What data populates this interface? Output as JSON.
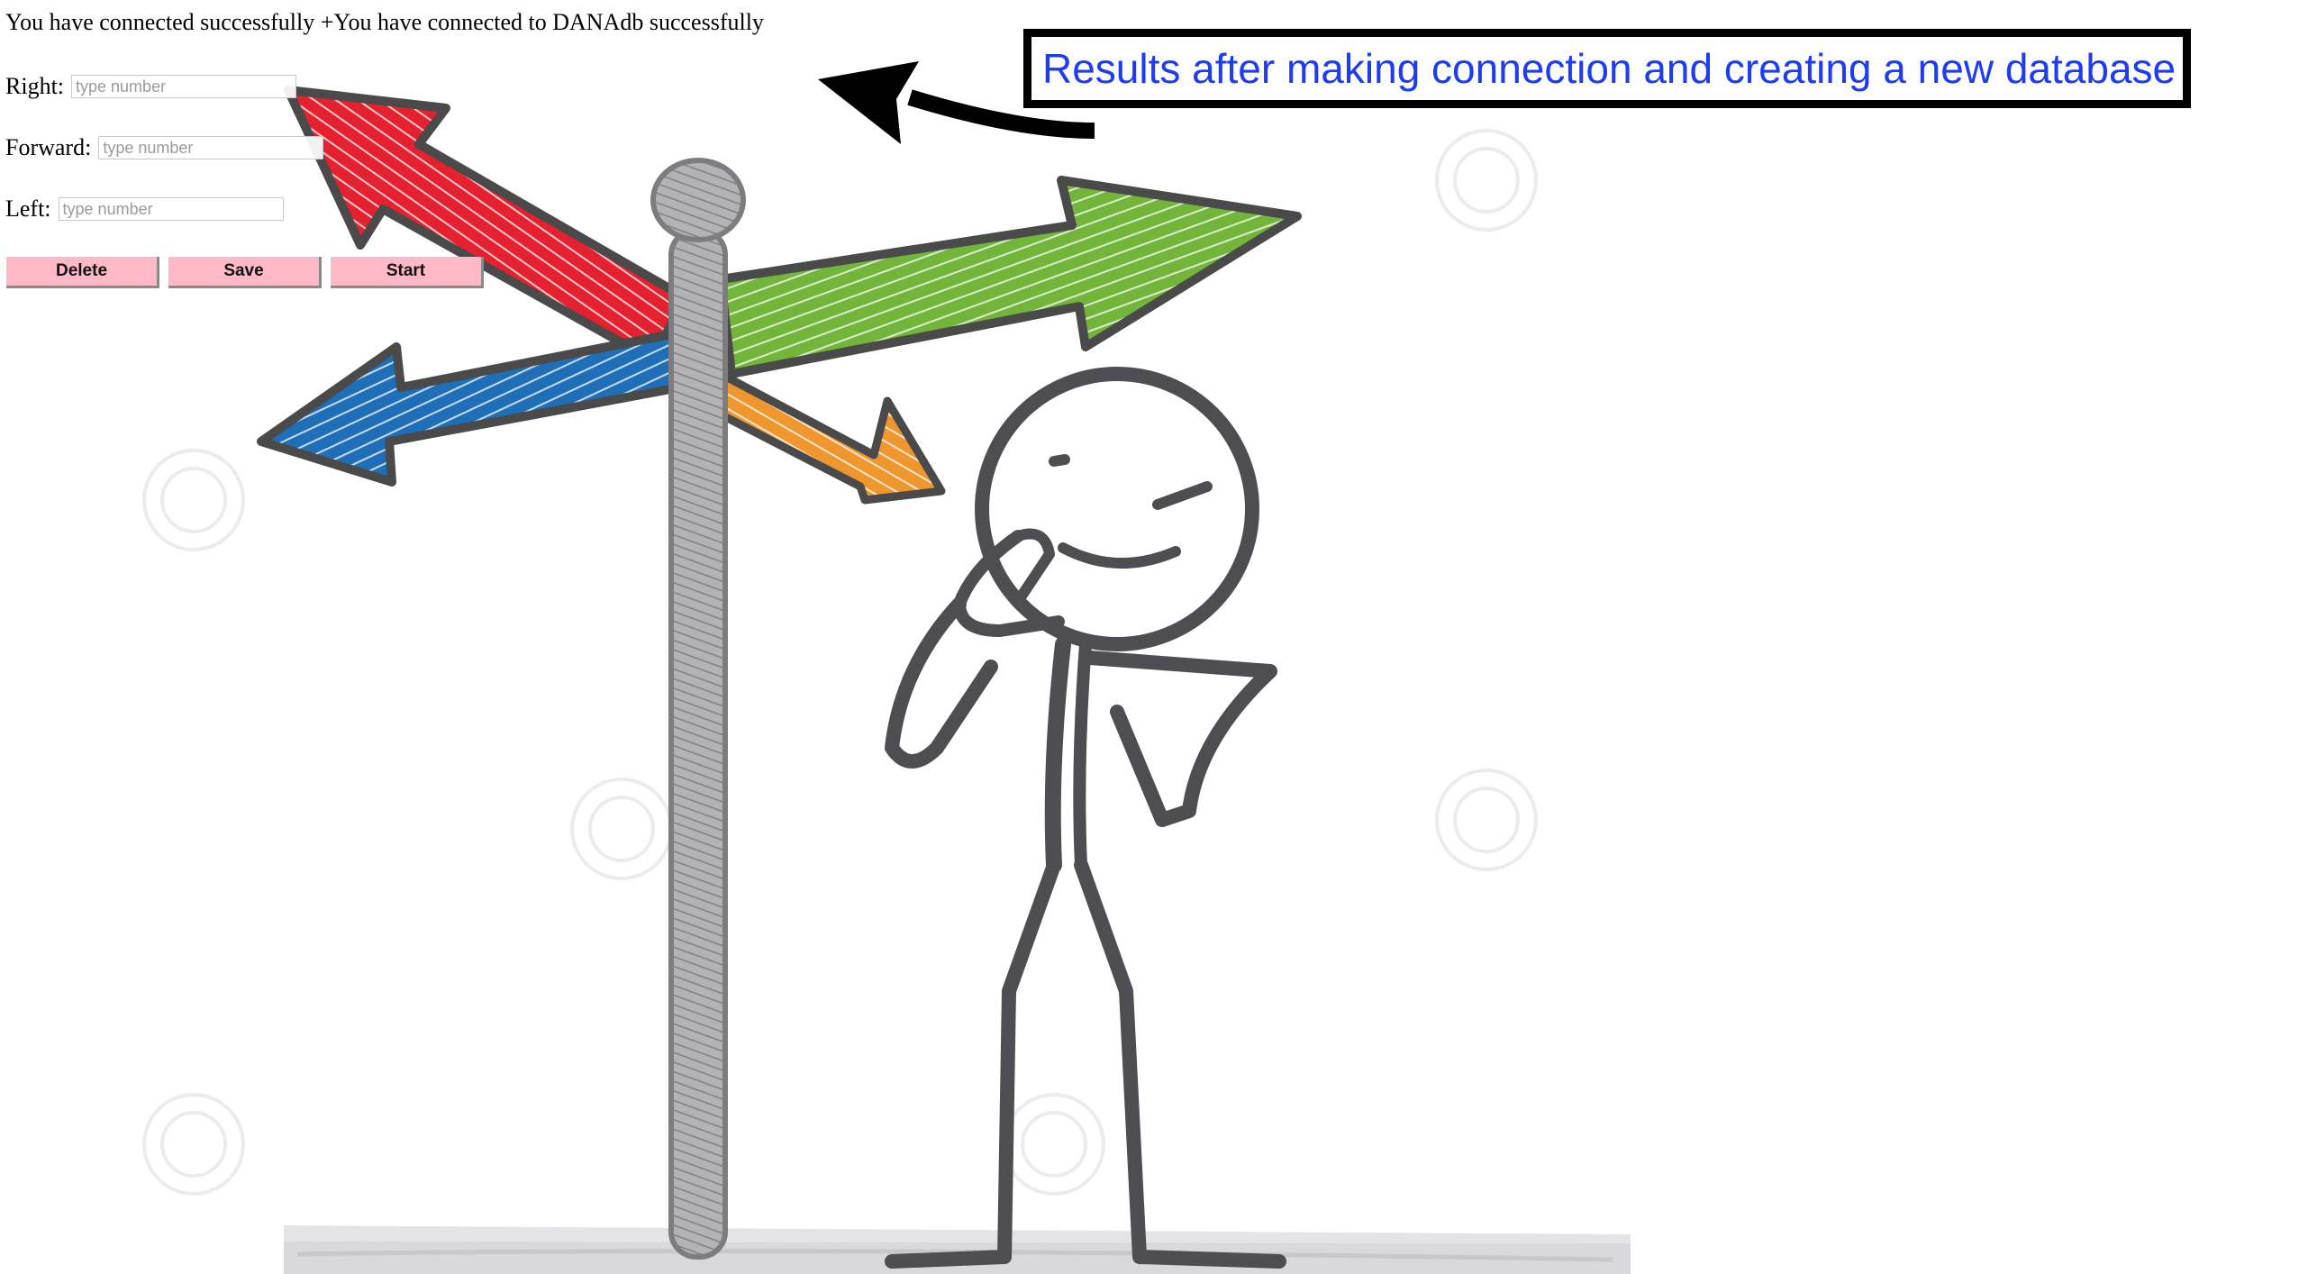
{
  "status": {
    "message": "You have connected successfully +You have connected to DANAdb successfully"
  },
  "form": {
    "fields": [
      {
        "label": "Right:",
        "placeholder": "type number",
        "value": ""
      },
      {
        "label": "Forward:",
        "placeholder": "type number",
        "value": ""
      },
      {
        "label": "Left:",
        "placeholder": "type number",
        "value": ""
      }
    ],
    "buttons": [
      {
        "label": "Delete"
      },
      {
        "label": "Save"
      },
      {
        "label": "Start"
      }
    ],
    "button_color": "#ffb8c6"
  },
  "annotation": {
    "callout_text": "Results after making connection and creating a new database",
    "text_color": "#1f3cf5",
    "border_color": "#000000"
  },
  "illustration": {
    "description_icons": [
      "signpost-icon",
      "thinking-stick-figure"
    ],
    "arrow_colors": {
      "red": "#e5212f",
      "green": "#73b53a",
      "blue": "#1f6fb8",
      "orange": "#f0962e"
    }
  }
}
